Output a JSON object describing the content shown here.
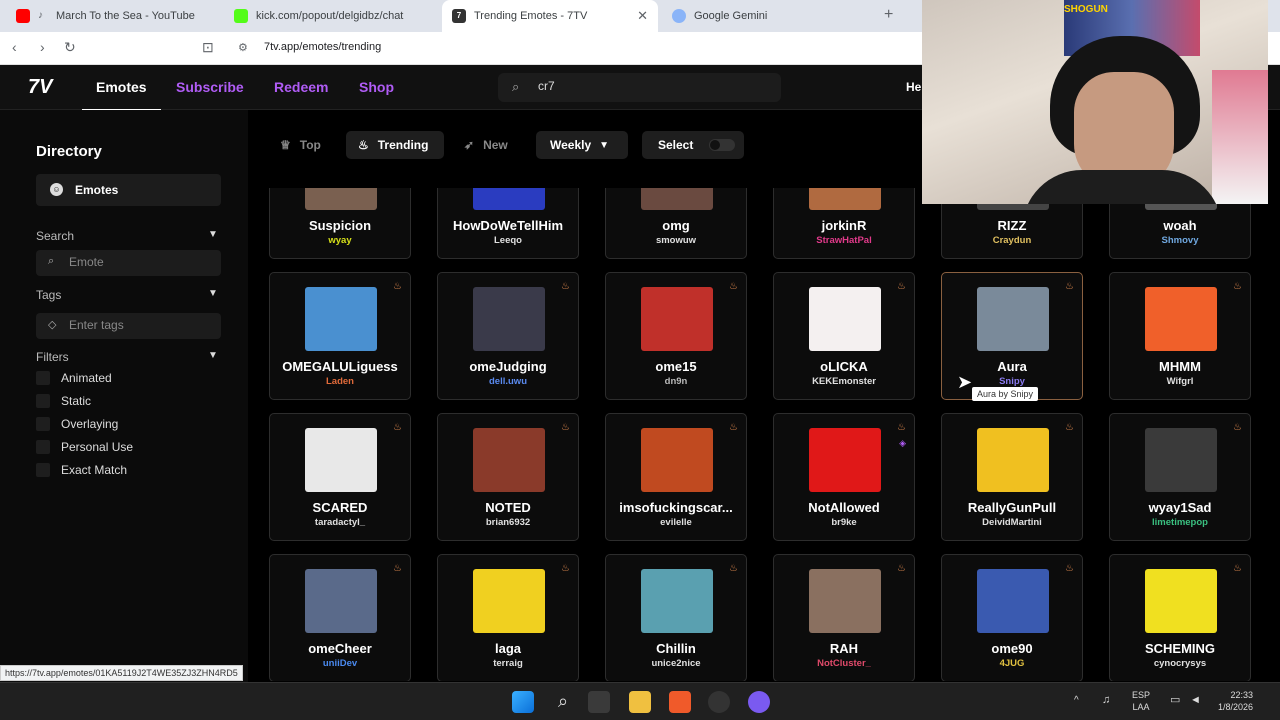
{
  "browser": {
    "tabs": [
      {
        "title": "March To the Sea - YouTube",
        "color": "#ff0000",
        "active": false
      },
      {
        "title": "kick.com/popout/delgidbz/chat",
        "color": "#53fc18",
        "active": false
      },
      {
        "title": "Trending Emotes - 7TV",
        "color": "#333333",
        "active": true
      },
      {
        "title": "Google Gemini",
        "color": "#8ab4f8",
        "active": false
      }
    ],
    "close_glyph": "✕",
    "new_tab_glyph": "+",
    "url": "7tv.app/emotes/trending",
    "status_url": "https://7tv.app/emotes/01KA5119J2T4WE35ZJ3ZHN4RD5"
  },
  "header": {
    "logo": "7V",
    "nav": [
      "Emotes",
      "Subscribe",
      "Redeem",
      "Shop"
    ],
    "search_value": "cr7",
    "user_cut": "He"
  },
  "sidebar": {
    "title": "Directory",
    "item": "Emotes",
    "search_label": "Search",
    "search_placeholder": "Emote",
    "tags_label": "Tags",
    "tags_placeholder": "Enter tags",
    "filters_label": "Filters",
    "filters": [
      "Animated",
      "Static",
      "Overlaying",
      "Personal Use",
      "Exact Match"
    ]
  },
  "toolbar": {
    "top": "Top",
    "trending": "Trending",
    "new": "New",
    "period": "Weekly",
    "select": "Select"
  },
  "emotes": [
    {
      "name": "Suspicion",
      "author": "wyay",
      "author_color": "#d6e01a",
      "thumb": "#7a6050"
    },
    {
      "name": "HowDoWeTellHim",
      "author": "Leeqo",
      "author_color": "#e0e0e0",
      "thumb": "#2a3cc0"
    },
    {
      "name": "omg",
      "author": "smowuw",
      "author_color": "#e0e0e0",
      "thumb": "#6a4a40"
    },
    {
      "name": "jorkinR",
      "author": "StrawHatPal",
      "author_color": "#e03a8a",
      "thumb": "#b06a40"
    },
    {
      "name": "RIZZ",
      "author": "Craydun",
      "author_color": "#e0c060",
      "thumb": "#444444"
    },
    {
      "name": "woah",
      "author": "Shmovy",
      "author_color": "#70a8e0",
      "thumb": "#555555"
    },
    {
      "name": "OMEGALULiguess",
      "author": "Laden",
      "author_color": "#e06a3a",
      "thumb": "#4a90d0"
    },
    {
      "name": "omeJudging",
      "author": "dell.uwu",
      "author_color": "#5a8af0",
      "thumb": "#3a3a4a"
    },
    {
      "name": "ome15",
      "author": "dn9n",
      "author_color": "#bbbbbb",
      "thumb": "#c0302a"
    },
    {
      "name": "oLICKA",
      "author": "KEKEmonster",
      "author_color": "#e0e0e0",
      "thumb": "#f4f0f0"
    },
    {
      "name": "Aura",
      "author": "Snipy",
      "author_color": "#8a7af0",
      "thumb": "#7a8a9a"
    },
    {
      "name": "MHMM",
      "author": "Wifgrl",
      "author_color": "#e0e0e0",
      "thumb": "#f0602a"
    },
    {
      "name": "SCARED",
      "author": "taradactyl_",
      "author_color": "#e0e0e0",
      "thumb": "#e8e8e8"
    },
    {
      "name": "NOTED",
      "author": "brian6932",
      "author_color": "#e0e0e0",
      "thumb": "#8a3a2a"
    },
    {
      "name": "imsofuckingscar...",
      "author": "evilelle",
      "author_color": "#e0e0e0",
      "thumb": "#c04a20"
    },
    {
      "name": "NotAllowed",
      "author": "br9ke",
      "author_color": "#e0e0e0",
      "thumb": "#e01818"
    },
    {
      "name": "ReallyGunPull",
      "author": "DeividMartini",
      "author_color": "#e0e0e0",
      "thumb": "#f0c020"
    },
    {
      "name": "wyay1Sad",
      "author": "limetimepop",
      "author_color": "#3ac080",
      "thumb": "#3a3a3a"
    },
    {
      "name": "omeCheer",
      "author": "uniiDev",
      "author_color": "#4a8af0",
      "thumb": "#5a6a8a"
    },
    {
      "name": "laga",
      "author": "terraig",
      "author_color": "#e0e0e0",
      "thumb": "#f0d020"
    },
    {
      "name": "Chillin",
      "author": "unice2nice",
      "author_color": "#e0e0e0",
      "thumb": "#5aa0b0"
    },
    {
      "name": "RAH",
      "author": "NotCluster_",
      "author_color": "#e04a6a",
      "thumb": "#8a7060"
    },
    {
      "name": "ome90",
      "author": "4JUG",
      "author_color": "#e0c040",
      "thumb": "#3a5ab0"
    },
    {
      "name": "SCHEMING",
      "author": "cynocrysys",
      "author_color": "#e0e0e0",
      "thumb": "#f0e020"
    }
  ],
  "tooltip": "Aura by Snipy",
  "webcam_text": "SHOGUN",
  "taskbar": {
    "lang": "ESP",
    "region": "LAA",
    "time": "22:33",
    "date": "1/8/2026"
  }
}
